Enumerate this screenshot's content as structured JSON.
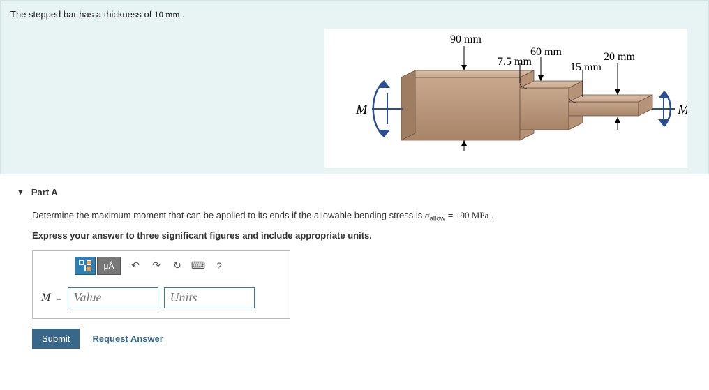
{
  "problem": {
    "statement_prefix": "The stepped bar has a thickness of ",
    "statement_value": "10 mm",
    "statement_suffix": " ."
  },
  "figure": {
    "dims": {
      "d90": "90 mm",
      "d60": "60 mm",
      "d7_5": "7.5 mm",
      "d20": "20 mm",
      "d15": "15 mm"
    },
    "moment_left": "M",
    "moment_right": "M"
  },
  "part": {
    "title": "Part A",
    "question_prefix": "Determine the maximum moment that can be applied to its ends if the allowable bending stress is ",
    "sigma_symbol": "σ",
    "sigma_sub": "allow",
    "equals": " = ",
    "sigma_value": "190 MPa",
    "question_suffix": " .",
    "instructions": "Express your answer to three significant figures and include appropriate units."
  },
  "toolbar": {
    "template_tooltip": "Templates",
    "special_label": "μÅ",
    "undo": "↶",
    "redo": "↷",
    "reset": "↻",
    "keyboard": "⌨",
    "help": "?"
  },
  "answer": {
    "label": "M",
    "eq": "=",
    "value_placeholder": "Value",
    "units_placeholder": "Units"
  },
  "actions": {
    "submit": "Submit",
    "request": "Request Answer"
  }
}
